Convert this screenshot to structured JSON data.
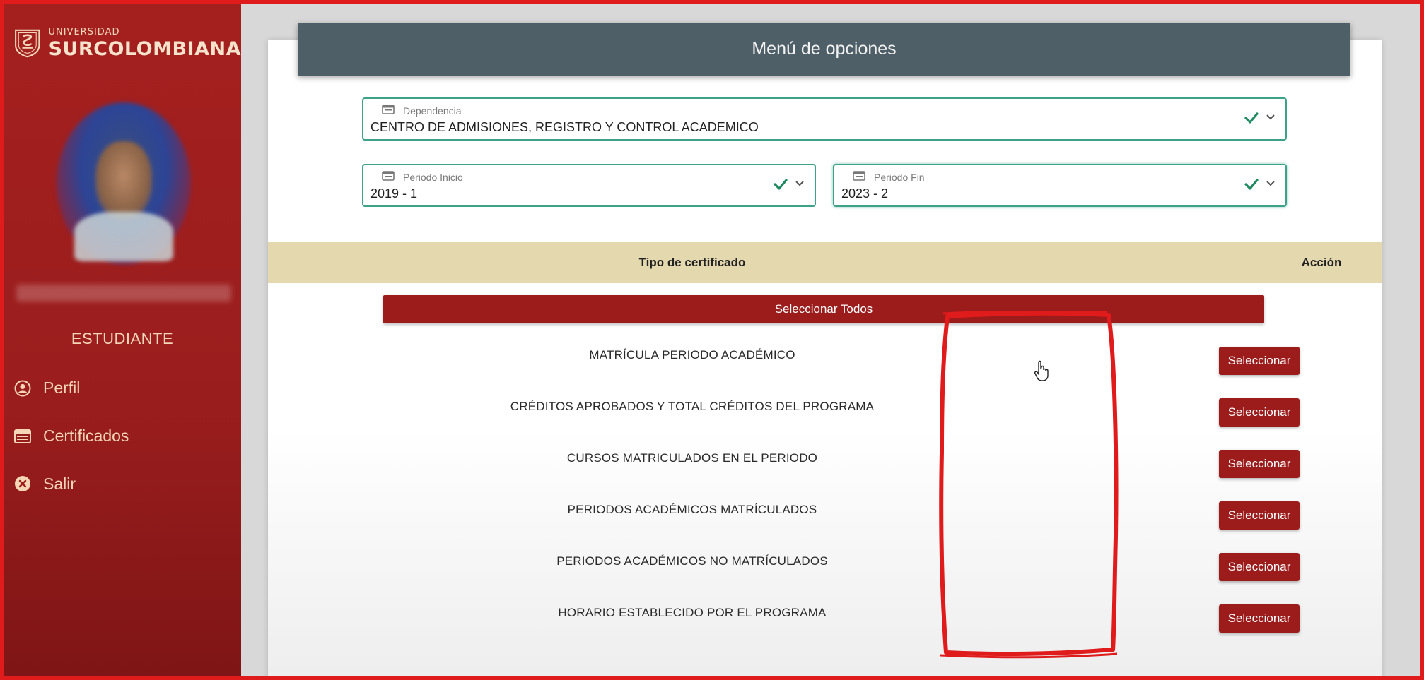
{
  "brand": {
    "small": "UNIVERSIDAD",
    "big": "SURCOLOMBIANA"
  },
  "sidebar": {
    "role": "ESTUDIANTE",
    "items": [
      {
        "label": "Perfil",
        "icon": "user-circle-icon"
      },
      {
        "label": "Certificados",
        "icon": "certificate-icon"
      },
      {
        "label": "Salir",
        "icon": "close-circle-icon"
      }
    ]
  },
  "header": {
    "title": "Menú de opciones"
  },
  "filters": {
    "dependencia": {
      "label": "Dependencia",
      "value": "CENTRO DE ADMISIONES, REGISTRO Y CONTROL ACADEMICO"
    },
    "periodo_inicio": {
      "label": "Periodo Inicio",
      "value": "2019 - 1"
    },
    "periodo_fin": {
      "label": "Periodo Fin",
      "value": "2023 - 2"
    }
  },
  "table": {
    "headers": {
      "tipo": "Tipo de certificado",
      "accion": "Acción"
    },
    "select_all_label": "Seleccionar Todos",
    "rows": [
      {
        "label": "MATRÍCULA PERIODO ACADÉMICO",
        "action": "Seleccionar"
      },
      {
        "label": "CRÉDITOS APROBADOS Y TOTAL CRÉDITOS DEL PROGRAMA",
        "action": "Seleccionar"
      },
      {
        "label": "CURSOS MATRICULADOS EN EL PERIODO",
        "action": "Seleccionar"
      },
      {
        "label": "PERIODOS ACADÉMICOS MATRÍCULADOS",
        "action": "Seleccionar"
      },
      {
        "label": "PERIODOS ACADÉMICOS NO MATRÍCULADOS",
        "action": "Seleccionar"
      },
      {
        "label": "HORARIO ESTABLECIDO POR EL PROGRAMA",
        "action": "Seleccionar"
      }
    ]
  },
  "colors": {
    "brand_red": "#9c1b1b",
    "header_gray": "#4e5f68",
    "table_head": "#e4d8af",
    "field_border": "#3ea28a",
    "annotation": "#e01b1b"
  }
}
